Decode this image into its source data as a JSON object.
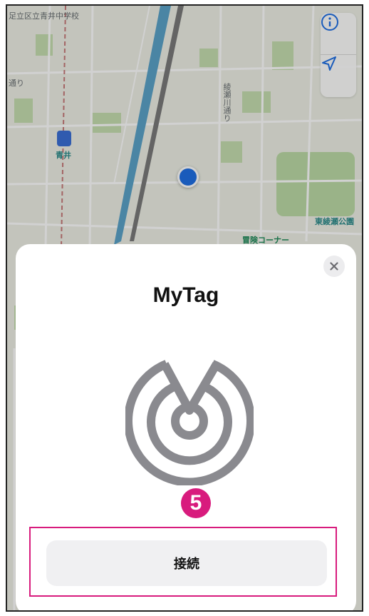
{
  "map": {
    "labels": {
      "school": "足立区立青井中学校",
      "road_left": "通り",
      "road_vertical": "綾瀬川通り",
      "station": "青井",
      "park": "東綾瀬公園",
      "adventure": "冒険コーナー"
    },
    "buttons": {
      "info_icon": "info-icon",
      "location_icon": "location-arrow-icon"
    }
  },
  "sheet": {
    "title": "MyTag",
    "close_icon": "close-icon",
    "radar_icon": "radar-icon",
    "step_number": "5",
    "connect_button_label": "接続"
  },
  "colors": {
    "accent": "#d81b7d",
    "location_dot": "#1f6fe5",
    "button_bg": "#f0f0f2"
  }
}
